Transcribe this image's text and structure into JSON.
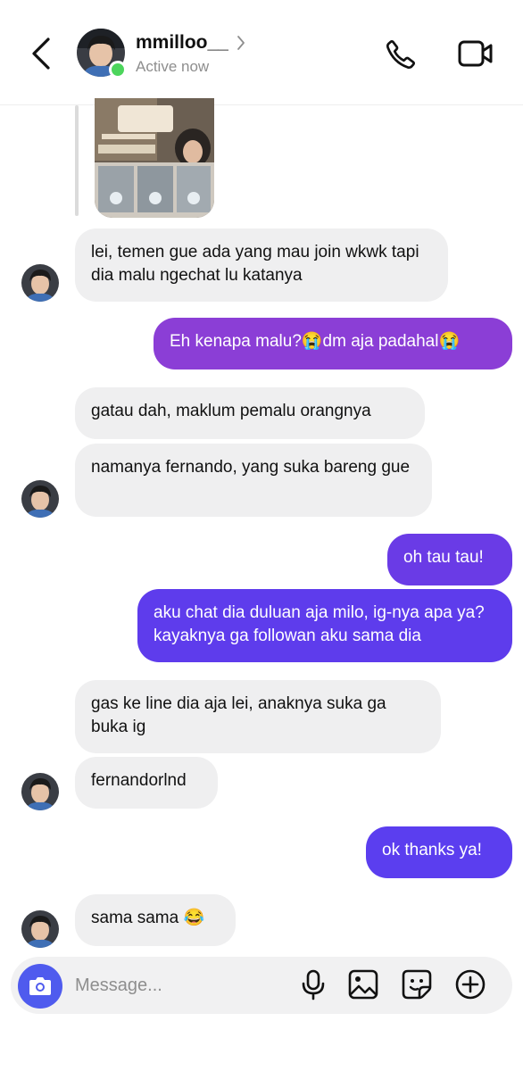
{
  "header": {
    "username": "mmilloo__",
    "status": "Active now"
  },
  "messages": [
    {
      "side": "in",
      "text": "lei, temen gue ada yang mau join wkwk tapi dia malu ngechat lu katanya"
    },
    {
      "side": "out",
      "text": "Eh kenapa malu?😭dm aja padahal😭"
    },
    {
      "side": "in",
      "text": "gatau dah, maklum pemalu orangnya"
    },
    {
      "side": "in",
      "text": "namanya fernando, yang suka bareng gue"
    },
    {
      "side": "out",
      "text": "oh tau tau!"
    },
    {
      "side": "out",
      "text": "aku chat dia duluan aja milo, ig-nya apa ya? kayaknya ga followan aku sama dia"
    },
    {
      "side": "in",
      "text": "gas ke line dia aja lei, anaknya suka ga buka ig"
    },
    {
      "side": "in",
      "text": "fernandorlnd"
    },
    {
      "side": "out",
      "text": "ok thanks ya!"
    },
    {
      "side": "in",
      "text": "sama sama 😂"
    }
  ],
  "composer": {
    "placeholder": "Message..."
  },
  "icons": {
    "back": "chevron-left-icon",
    "call": "phone-icon",
    "video": "video-camera-icon",
    "camera": "camera-icon",
    "mic": "microphone-icon",
    "gallery": "image-icon",
    "sticker": "sticker-icon",
    "more": "plus-circle-icon"
  },
  "colors": {
    "outgoing_top": "#8b3ed6",
    "outgoing_bottom": "#5b3eef",
    "incoming": "#efeff0",
    "online": "#4cd55c",
    "camera_button": "#4f5bee"
  }
}
